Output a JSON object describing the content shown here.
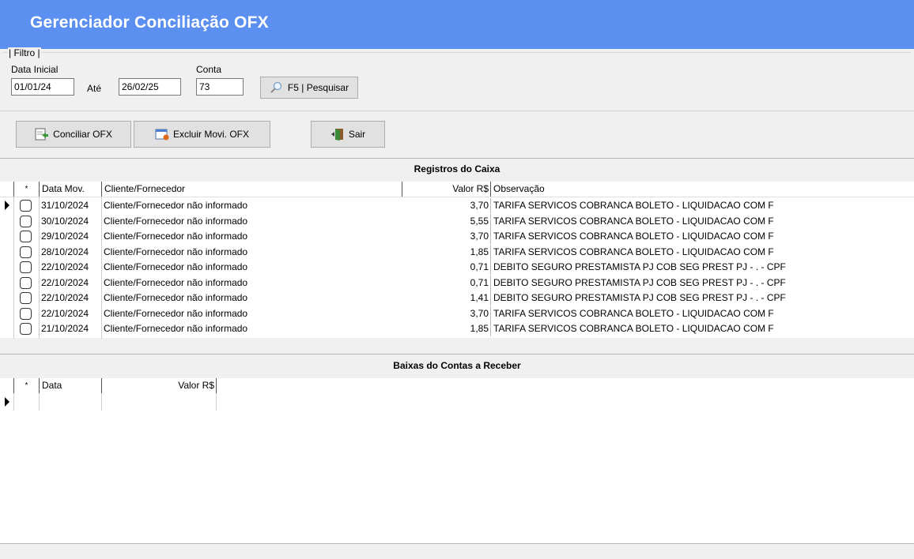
{
  "window": {
    "title": "Gerenciador Conciliação OFX"
  },
  "filter": {
    "legend": "| Filtro |",
    "data_inicial_label": "Data Inicial",
    "data_inicial_value": "01/01/24",
    "ate_label": "Até",
    "data_final_value": "26/02/25",
    "conta_label": "Conta",
    "conta_value": "73",
    "search_button": "F5 | Pesquisar"
  },
  "actions": {
    "conciliar": "Conciliar OFX",
    "excluir": "Excluir Movi. OFX",
    "sair": "Sair"
  },
  "registros": {
    "title": "Registros do Caixa",
    "columns": {
      "star": "*",
      "data": "Data Mov.",
      "cliente": "Cliente/Fornecedor",
      "valor": "Valor R$",
      "obs": "Observação"
    },
    "rows": [
      {
        "data": "31/10/2024",
        "cliente": "Cliente/Fornecedor não informado",
        "valor": "3,70",
        "obs": "TARIFA SERVICOS COBRANCA BOLETO   - LIQUIDACAO COM F"
      },
      {
        "data": "30/10/2024",
        "cliente": "Cliente/Fornecedor não informado",
        "valor": "5,55",
        "obs": "TARIFA SERVICOS COBRANCA BOLETO   - LIQUIDACAO COM F"
      },
      {
        "data": "29/10/2024",
        "cliente": "Cliente/Fornecedor não informado",
        "valor": "3,70",
        "obs": "TARIFA SERVICOS COBRANCA BOLETO   - LIQUIDACAO COM F"
      },
      {
        "data": "28/10/2024",
        "cliente": "Cliente/Fornecedor não informado",
        "valor": "1,85",
        "obs": "TARIFA SERVICOS COBRANCA BOLETO   - LIQUIDACAO COM F"
      },
      {
        "data": "22/10/2024",
        "cliente": "Cliente/Fornecedor não informado",
        "valor": "0,71",
        "obs": "DEBITO SEGURO PRESTAMISTA PJ COB SEG PREST PJ - . - CPF"
      },
      {
        "data": "22/10/2024",
        "cliente": "Cliente/Fornecedor não informado",
        "valor": "0,71",
        "obs": "DEBITO SEGURO PRESTAMISTA PJ COB SEG PREST PJ - . - CPF"
      },
      {
        "data": "22/10/2024",
        "cliente": "Cliente/Fornecedor não informado",
        "valor": "1,41",
        "obs": "DEBITO SEGURO PRESTAMISTA PJ COB SEG PREST PJ - . - CPF"
      },
      {
        "data": "22/10/2024",
        "cliente": "Cliente/Fornecedor não informado",
        "valor": "3,70",
        "obs": "TARIFA SERVICOS COBRANCA BOLETO   - LIQUIDACAO COM F"
      },
      {
        "data": "21/10/2024",
        "cliente": "Cliente/Fornecedor não informado",
        "valor": "1,85",
        "obs": "TARIFA SERVICOS COBRANCA BOLETO   - LIQUIDACAO COM F"
      }
    ]
  },
  "baixas": {
    "title": "Baixas do Contas a Receber",
    "columns": {
      "star": "*",
      "data": "Data",
      "valor": "Valor R$"
    }
  }
}
